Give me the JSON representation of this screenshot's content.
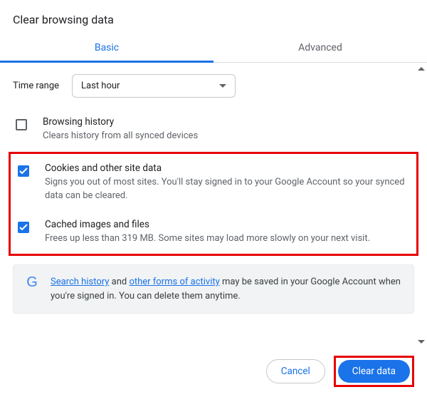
{
  "dialog": {
    "title": "Clear browsing data"
  },
  "tabs": {
    "basic": "Basic",
    "advanced": "Advanced"
  },
  "timerange": {
    "label": "Time range",
    "value": "Last hour"
  },
  "options": {
    "history": {
      "title": "Browsing history",
      "desc": "Clears history from all synced devices",
      "checked": false
    },
    "cookies": {
      "title": "Cookies and other site data",
      "desc": "Signs you out of most sites. You'll stay signed in to your Google Account so your synced data can be cleared.",
      "checked": true
    },
    "cache": {
      "title": "Cached images and files",
      "desc": "Frees up less than 319 MB. Some sites may load more slowly on your next visit.",
      "checked": true
    }
  },
  "info": {
    "link1": "Search history",
    "mid1": " and ",
    "link2": "other forms of activity",
    "rest": " may be saved in your Google Account when you're signed in. You can delete them anytime."
  },
  "buttons": {
    "cancel": "Cancel",
    "clear": "Clear data"
  }
}
